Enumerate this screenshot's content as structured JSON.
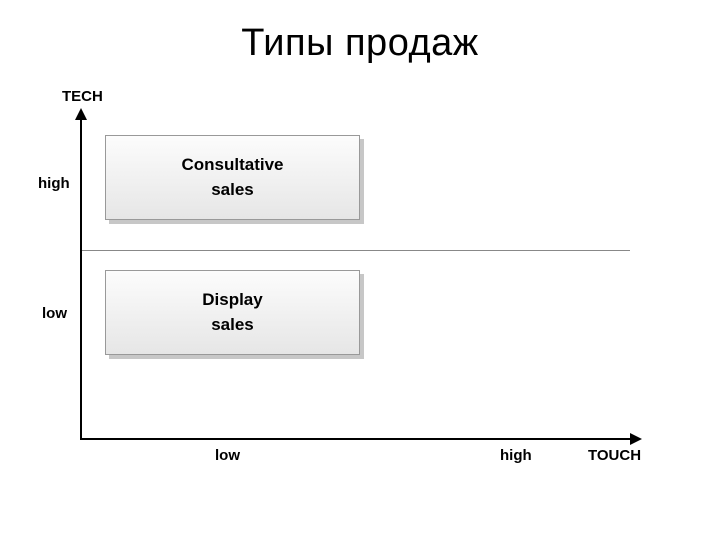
{
  "title": "Типы продаж",
  "axes": {
    "y_title": "TECH",
    "y_high": "high",
    "y_low": "low",
    "x_low": "low",
    "x_high": "high",
    "x_title": "TOUCH"
  },
  "boxes": {
    "top": {
      "line1": "Consultative",
      "line2": "sales"
    },
    "bottom": {
      "line1": "Display",
      "line2": "sales"
    }
  },
  "chart_data": {
    "type": "table",
    "title": "Типы продаж",
    "xlabel": "TOUCH",
    "ylabel": "TECH",
    "categories_x": [
      "low",
      "high"
    ],
    "categories_y": [
      "high",
      "low"
    ],
    "cells": [
      {
        "tech": "high",
        "touch": "low",
        "label": "Consultative sales"
      },
      {
        "tech": "low",
        "touch": "low",
        "label": "Display sales"
      }
    ]
  }
}
